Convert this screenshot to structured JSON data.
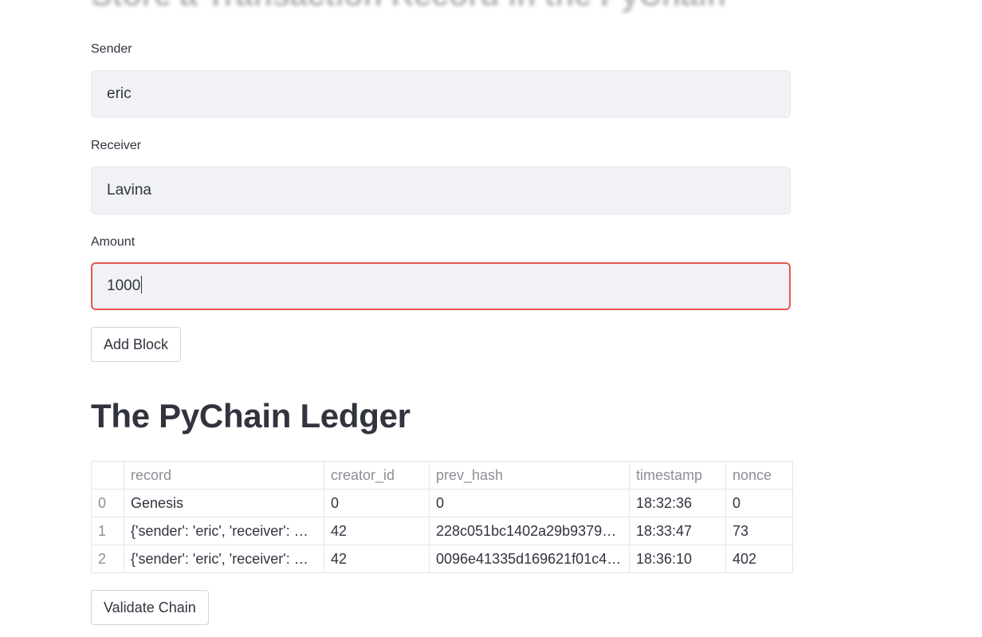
{
  "page": {
    "faded_title": "Store a Transaction Record in the PyChain"
  },
  "form": {
    "sender": {
      "label": "Sender",
      "value": "eric"
    },
    "receiver": {
      "label": "Receiver",
      "value": "Lavina"
    },
    "amount": {
      "label": "Amount",
      "value": "1000"
    },
    "add_block_label": "Add Block"
  },
  "ledger": {
    "title": "The PyChain Ledger",
    "columns": [
      "",
      "record",
      "creator_id",
      "prev_hash",
      "timestamp",
      "nonce"
    ],
    "rows": [
      {
        "index": "0",
        "record": "Genesis",
        "creator_id": "0",
        "prev_hash": "0",
        "timestamp": "18:32:36",
        "nonce": "0"
      },
      {
        "index": "1",
        "record": "{'sender': 'eric', 'receiver': …",
        "creator_id": "42",
        "prev_hash": "228c051bc1402a29b9379…",
        "timestamp": "18:33:47",
        "nonce": "73"
      },
      {
        "index": "2",
        "record": "{'sender': 'eric', 'receiver': …",
        "creator_id": "42",
        "prev_hash": "0096e41335d169621f01c4…",
        "timestamp": "18:36:10",
        "nonce": "402"
      }
    ],
    "validate_label": "Validate Chain"
  },
  "colors": {
    "focus_border": "#e8564e",
    "input_bg": "#f0f2f6",
    "text": "#31333f"
  }
}
